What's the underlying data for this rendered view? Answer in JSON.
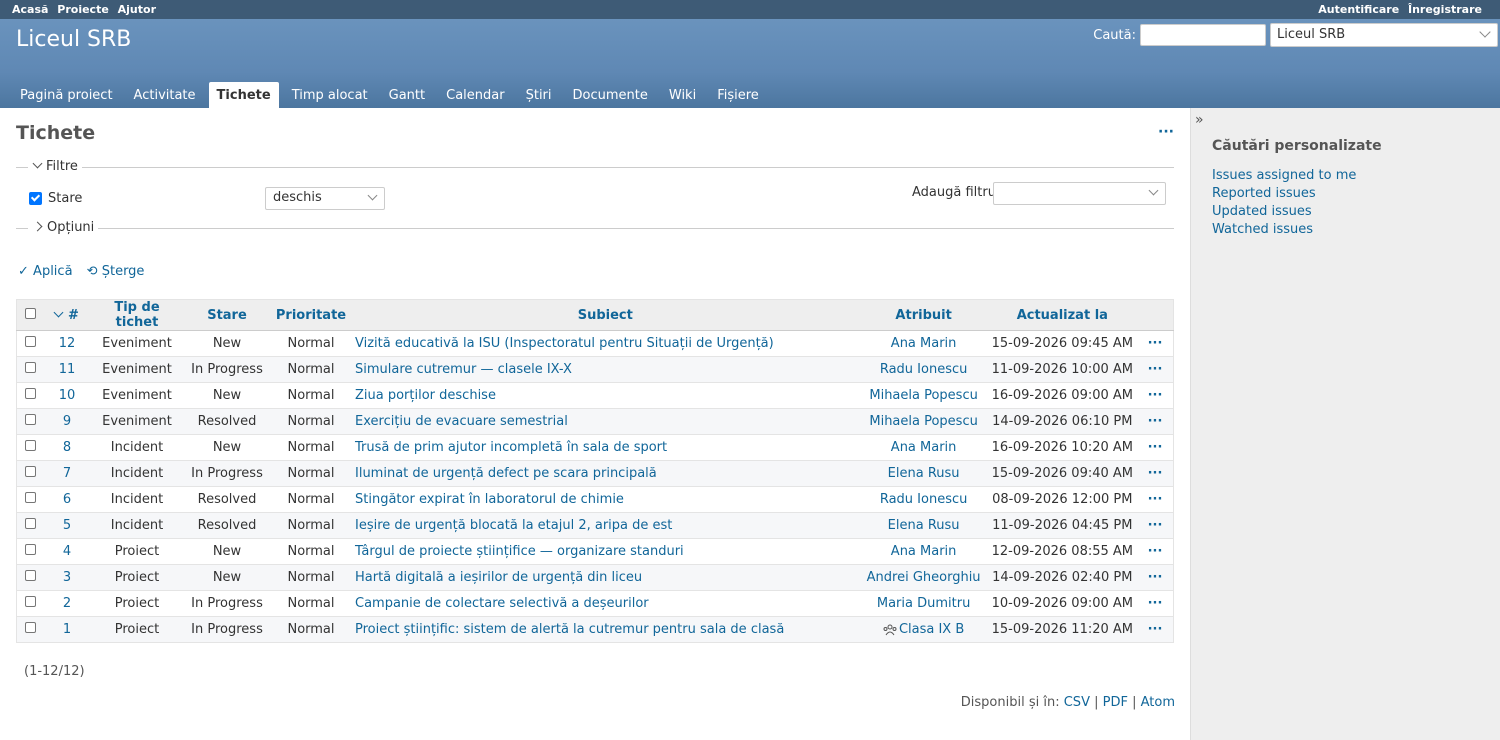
{
  "top_menu": {
    "left": [
      "Acasă",
      "Proiecte",
      "Ajutor"
    ],
    "right": [
      "Autentificare",
      "Înregistrare"
    ]
  },
  "header": {
    "title": "Liceul SRB",
    "search_label": "Caută:",
    "search_value": "",
    "project_select": "Liceul SRB"
  },
  "tabs": [
    {
      "label": "Pagină proiect",
      "selected": false
    },
    {
      "label": "Activitate",
      "selected": false
    },
    {
      "label": "Tichete",
      "selected": true
    },
    {
      "label": "Timp alocat",
      "selected": false
    },
    {
      "label": "Gantt",
      "selected": false
    },
    {
      "label": "Calendar",
      "selected": false
    },
    {
      "label": "Știri",
      "selected": false
    },
    {
      "label": "Documente",
      "selected": false
    },
    {
      "label": "Wiki",
      "selected": false
    },
    {
      "label": "Fișiere",
      "selected": false
    }
  ],
  "page": {
    "title": "Tichete",
    "filters_legend": "Filtre",
    "filter_status_label": "Stare",
    "filter_status_value": "deschis",
    "add_filter_label": "Adaugă filtru",
    "add_filter_value": "",
    "options_legend": "Opțiuni",
    "apply_label": "Aplică",
    "clear_label": "Șterge"
  },
  "table": {
    "headers": [
      "#",
      "Tip de tichet",
      "Stare",
      "Prioritate",
      "Subiect",
      "Atribuit",
      "Actualizat la"
    ],
    "rows": [
      {
        "id": "12",
        "tracker": "Eveniment",
        "status": "New",
        "priority": "Normal",
        "subject": "Vizită educativă la ISU (Inspectoratul pentru Situații de Urgență)",
        "assignee": "Ana Marin",
        "updated": "15-09-2026 09:45 AM"
      },
      {
        "id": "11",
        "tracker": "Eveniment",
        "status": "In Progress",
        "priority": "Normal",
        "subject": "Simulare cutremur — clasele IX-X",
        "assignee": "Radu Ionescu",
        "updated": "11-09-2026 10:00 AM"
      },
      {
        "id": "10",
        "tracker": "Eveniment",
        "status": "New",
        "priority": "Normal",
        "subject": "Ziua porților deschise",
        "assignee": "Mihaela Popescu",
        "updated": "16-09-2026 09:00 AM"
      },
      {
        "id": "9",
        "tracker": "Eveniment",
        "status": "Resolved",
        "priority": "Normal",
        "subject": "Exercițiu de evacuare semestrial",
        "assignee": "Mihaela Popescu",
        "updated": "14-09-2026 06:10 PM"
      },
      {
        "id": "8",
        "tracker": "Incident",
        "status": "New",
        "priority": "Normal",
        "subject": "Trusă de prim ajutor incompletă în sala de sport",
        "assignee": "Ana Marin",
        "updated": "16-09-2026 10:20 AM"
      },
      {
        "id": "7",
        "tracker": "Incident",
        "status": "In Progress",
        "priority": "Normal",
        "subject": "Iluminat de urgență defect pe scara principală",
        "assignee": "Elena Rusu",
        "updated": "15-09-2026 09:40 AM"
      },
      {
        "id": "6",
        "tracker": "Incident",
        "status": "Resolved",
        "priority": "Normal",
        "subject": "Stingător expirat în laboratorul de chimie",
        "assignee": "Radu Ionescu",
        "updated": "08-09-2026 12:00 PM"
      },
      {
        "id": "5",
        "tracker": "Incident",
        "status": "Resolved",
        "priority": "Normal",
        "subject": "Ieșire de urgență blocată la etajul 2, aripa de est",
        "assignee": "Elena Rusu",
        "updated": "11-09-2026 04:45 PM"
      },
      {
        "id": "4",
        "tracker": "Proiect",
        "status": "New",
        "priority": "Normal",
        "subject": "Târgul de proiecte științifice — organizare standuri",
        "assignee": "Ana Marin",
        "updated": "12-09-2026 08:55 AM"
      },
      {
        "id": "3",
        "tracker": "Proiect",
        "status": "New",
        "priority": "Normal",
        "subject": "Hartă digitală a ieșirilor de urgență din liceu",
        "assignee": "Andrei Gheorghiu",
        "updated": "14-09-2026 02:40 PM"
      },
      {
        "id": "2",
        "tracker": "Proiect",
        "status": "In Progress",
        "priority": "Normal",
        "subject": "Campanie de colectare selectivă a deșeurilor",
        "assignee": "Maria Dumitru",
        "updated": "10-09-2026 09:00 AM"
      },
      {
        "id": "1",
        "tracker": "Proiect",
        "status": "In Progress",
        "priority": "Normal",
        "subject": "Proiect științific: sistem de alertă la cutremur pentru sala de clasă",
        "assignee": "Clasa IX B",
        "assignee_is_group": true,
        "updated": "15-09-2026 11:20 AM"
      }
    ]
  },
  "pagination": "(1-12/12)",
  "other_formats": {
    "label": "Disponibil și în:",
    "links": [
      "CSV",
      "PDF",
      "Atom"
    ]
  },
  "sidebar": {
    "heading": "Căutări personalizate",
    "queries": [
      "Issues assigned to me",
      "Reported issues",
      "Updated issues",
      "Watched issues"
    ]
  }
}
